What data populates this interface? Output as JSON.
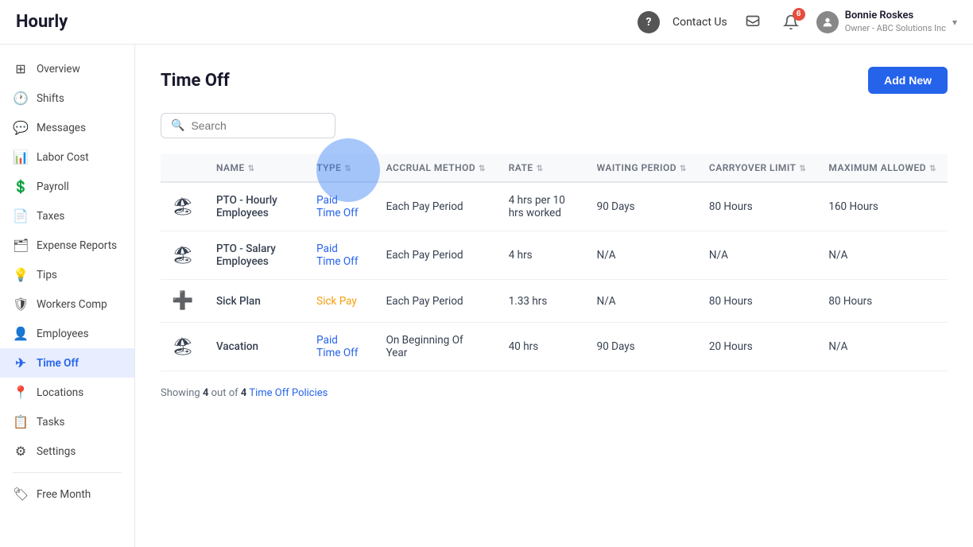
{
  "header": {
    "logo": "Hourly",
    "help_icon": "?",
    "contact_label": "Contact Us",
    "notification_count": "6",
    "user": {
      "name": "Bonnie Roskes",
      "org": "Owner - ABC Solutions Inc",
      "chevron": "▾"
    }
  },
  "sidebar": {
    "items": [
      {
        "id": "overview",
        "label": "Overview",
        "icon": "⊞",
        "active": false
      },
      {
        "id": "shifts",
        "label": "Shifts",
        "icon": "🕐",
        "active": false
      },
      {
        "id": "messages",
        "label": "Messages",
        "icon": "💬",
        "active": false
      },
      {
        "id": "labor-cost",
        "label": "Labor Cost",
        "icon": "📊",
        "active": false
      },
      {
        "id": "payroll",
        "label": "Payroll",
        "icon": "💲",
        "active": false
      },
      {
        "id": "taxes",
        "label": "Taxes",
        "icon": "📄",
        "active": false
      },
      {
        "id": "expense-reports",
        "label": "Expense Reports",
        "icon": "🗂",
        "active": false
      },
      {
        "id": "tips",
        "label": "Tips",
        "icon": "💡",
        "active": false
      },
      {
        "id": "workers-comp",
        "label": "Workers Comp",
        "icon": "🛡",
        "active": false
      },
      {
        "id": "employees",
        "label": "Employees",
        "icon": "👤",
        "active": false
      },
      {
        "id": "time-off",
        "label": "Time Off",
        "icon": "✈",
        "active": true
      },
      {
        "id": "locations",
        "label": "Locations",
        "icon": "📍",
        "active": false
      },
      {
        "id": "tasks",
        "label": "Tasks",
        "icon": "📋",
        "active": false
      },
      {
        "id": "settings",
        "label": "Settings",
        "icon": "⚙",
        "active": false
      },
      {
        "id": "free-month",
        "label": "Free Month",
        "icon": "🏷",
        "active": false
      }
    ]
  },
  "main": {
    "title": "Time Off",
    "add_button": "Add New",
    "search_placeholder": "Search",
    "table": {
      "columns": [
        {
          "key": "name",
          "label": "NAME"
        },
        {
          "key": "type",
          "label": "TYPE"
        },
        {
          "key": "accrual_method",
          "label": "ACCRUAL METHOD"
        },
        {
          "key": "rate",
          "label": "RATE"
        },
        {
          "key": "waiting_period",
          "label": "WAITING PERIOD"
        },
        {
          "key": "carryover_limit",
          "label": "CARRYOVER LIMIT"
        },
        {
          "key": "maximum_allowed",
          "label": "MAXIMUM ALLOWED"
        }
      ],
      "rows": [
        {
          "icon": "🏖",
          "name": "PTO - Hourly Employees",
          "type": "Paid Time Off",
          "type_style": "pto",
          "accrual_method": "Each Pay Period",
          "rate": "4 hrs per 10 hrs worked",
          "waiting_period": "90 Days",
          "carryover_limit": "80 Hours",
          "maximum_allowed": "160 Hours"
        },
        {
          "icon": "🏖",
          "name": "PTO - Salary Employees",
          "type": "Paid Time Off",
          "type_style": "pto",
          "accrual_method": "Each Pay Period",
          "rate": "4 hrs",
          "waiting_period": "N/A",
          "carryover_limit": "N/A",
          "maximum_allowed": "N/A"
        },
        {
          "icon": "➕",
          "name": "Sick Plan",
          "type": "Sick Pay",
          "type_style": "sick",
          "accrual_method": "Each Pay Period",
          "rate": "1.33 hrs",
          "waiting_period": "N/A",
          "carryover_limit": "80 Hours",
          "maximum_allowed": "80 Hours"
        },
        {
          "icon": "🏖",
          "name": "Vacation",
          "type": "Paid Time Off",
          "type_style": "pto",
          "accrual_method": "On Beginning Of Year",
          "rate": "40 hrs",
          "waiting_period": "90 Days",
          "carryover_limit": "20 Hours",
          "maximum_allowed": "N/A"
        }
      ]
    },
    "footer": {
      "prefix": "Showing ",
      "count": "4",
      "separator": " out of ",
      "total": "4",
      "suffix": " Time Off Policies"
    }
  }
}
